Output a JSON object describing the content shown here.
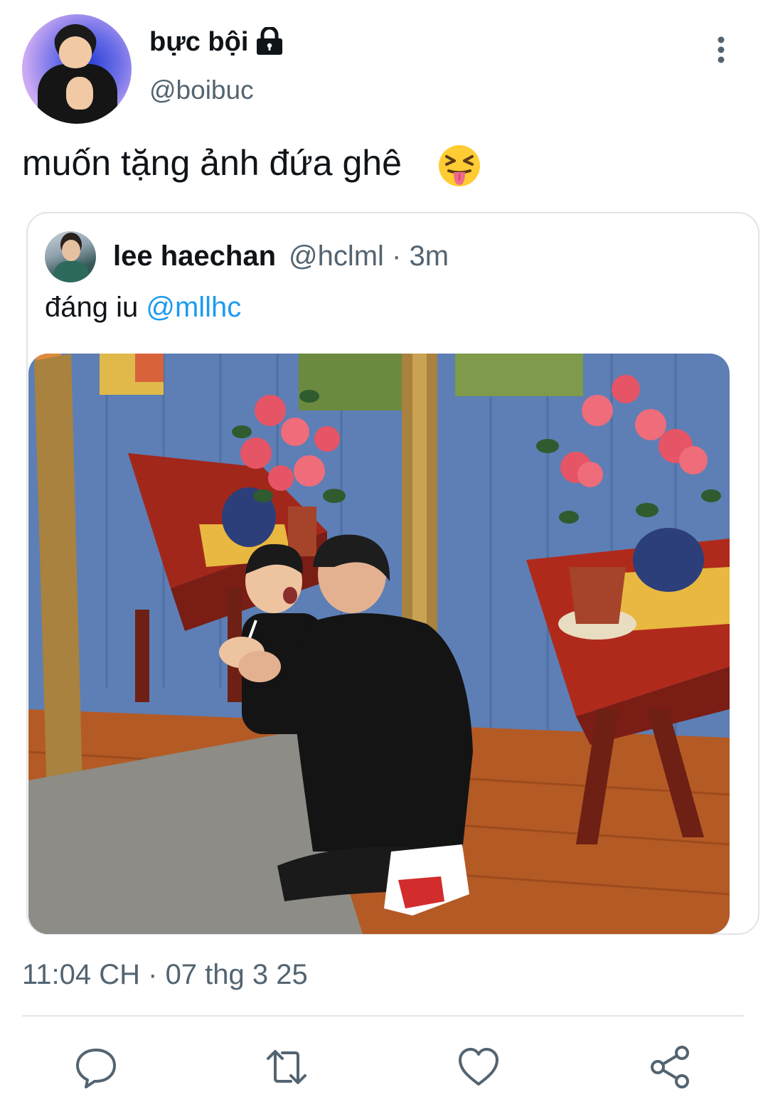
{
  "author": {
    "name": "bực bội",
    "handle": "@boibuc",
    "locked": true
  },
  "tweet": {
    "text": "muốn tặng ảnh đứa ghê",
    "emoji": "squinting-face-with-tongue"
  },
  "quoted_tweet": {
    "author_name": "lee haechan",
    "handle_and_time": "@hclml · 3m",
    "text": "đáng iu",
    "mention": "@mllhc"
  },
  "meta": {
    "timestamp": "11:04 CH · 07 thg 3 25"
  },
  "actions": [
    "reply-icon",
    "retweet-icon",
    "like-icon",
    "share-icon"
  ],
  "colors": {
    "text": "#0f1419",
    "secondary": "#536471",
    "link": "#1d9bf0",
    "border": "#dfe4e8"
  }
}
